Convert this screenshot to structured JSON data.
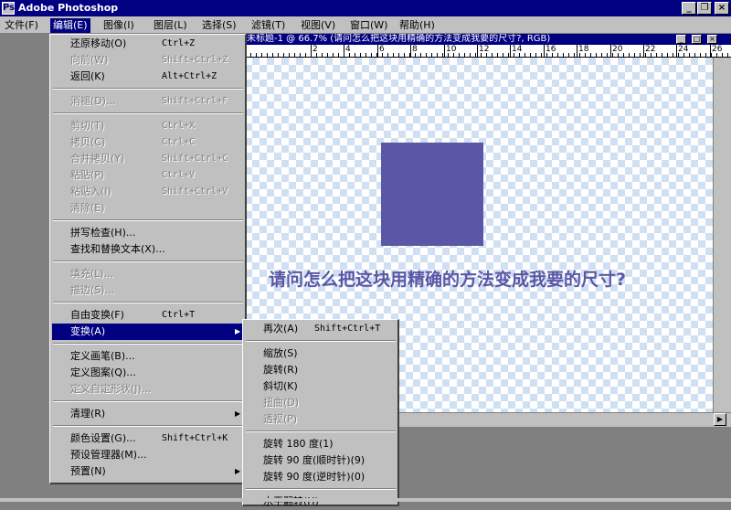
{
  "window": {
    "title": "Adobe Photoshop",
    "controls": [
      "_",
      "❐",
      "×"
    ]
  },
  "menubar": [
    {
      "label": "文件(F)"
    },
    {
      "label": "编辑(E)"
    },
    {
      "label": "图像(I)"
    },
    {
      "label": "图层(L)"
    },
    {
      "label": "选择(S)"
    },
    {
      "label": "滤镜(T)"
    },
    {
      "label": "视图(V)"
    },
    {
      "label": "窗口(W)"
    },
    {
      "label": "帮助(H)"
    }
  ],
  "document": {
    "title": "未标题-1 @ 66.7% (请问怎么把这块用精确的方法变成我要的尺寸?, RGB)",
    "controls": [
      "_",
      "□",
      "×"
    ],
    "ruler_numbers": [
      "2",
      "4",
      "6",
      "8",
      "10",
      "12",
      "14",
      "16",
      "18",
      "20",
      "22",
      "24",
      "26"
    ],
    "canvas_text": "请问怎么把这块用精确的方法变成我要的尺寸?",
    "colors": {
      "square": "#5a58a6",
      "checker": "#cfe0f3"
    }
  },
  "edit_menu": [
    {
      "label": "还原移动(O)",
      "shortcut": "Ctrl+Z",
      "disabled": false
    },
    {
      "label": "向前(W)",
      "shortcut": "Shift+Ctrl+Z",
      "disabled": true
    },
    {
      "label": "返回(K)",
      "shortcut": "Alt+Ctrl+Z",
      "disabled": false
    },
    {
      "sep": true
    },
    {
      "label": "消褪(D)...",
      "shortcut": "Shift+Ctrl+F",
      "disabled": true
    },
    {
      "sep": true
    },
    {
      "label": "剪切(T)",
      "shortcut": "Ctrl+X",
      "disabled": true
    },
    {
      "label": "拷贝(C)",
      "shortcut": "Ctrl+C",
      "disabled": true
    },
    {
      "label": "合并拷贝(Y)",
      "shortcut": "Shift+Ctrl+C",
      "disabled": true
    },
    {
      "label": "粘贴(P)",
      "shortcut": "Ctrl+V",
      "disabled": true
    },
    {
      "label": "粘贴入(I)",
      "shortcut": "Shift+Ctrl+V",
      "disabled": true
    },
    {
      "label": "清除(E)",
      "shortcut": "",
      "disabled": true
    },
    {
      "sep": true
    },
    {
      "label": "拼写检查(H)...",
      "shortcut": "",
      "disabled": false
    },
    {
      "label": "查找和替换文本(X)...",
      "shortcut": "",
      "disabled": false
    },
    {
      "sep": true
    },
    {
      "label": "填充(L)...",
      "shortcut": "",
      "disabled": true
    },
    {
      "label": "描边(S)...",
      "shortcut": "",
      "disabled": true
    },
    {
      "sep": true
    },
    {
      "label": "自由变换(F)",
      "shortcut": "Ctrl+T",
      "disabled": false
    },
    {
      "label": "变换(A)",
      "shortcut": "",
      "disabled": false,
      "submenu": true,
      "highlight": true
    },
    {
      "sep": true
    },
    {
      "label": "定义画笔(B)...",
      "shortcut": "",
      "disabled": false
    },
    {
      "label": "定义图案(Q)...",
      "shortcut": "",
      "disabled": false
    },
    {
      "label": "定义自定形状(J)...",
      "shortcut": "",
      "disabled": true
    },
    {
      "sep": true
    },
    {
      "label": "清理(R)",
      "shortcut": "",
      "disabled": false,
      "submenu": true
    },
    {
      "sep": true
    },
    {
      "label": "颜色设置(G)...",
      "shortcut": "Shift+Ctrl+K",
      "disabled": false
    },
    {
      "label": "预设管理器(M)...",
      "shortcut": "",
      "disabled": false
    },
    {
      "label": "预置(N)",
      "shortcut": "",
      "disabled": false,
      "submenu": true
    }
  ],
  "transform_menu": [
    {
      "label": "再次(A)",
      "shortcut": "Shift+Ctrl+T",
      "disabled": false
    },
    {
      "sep": true
    },
    {
      "label": "缩放(S)",
      "shortcut": "",
      "disabled": false
    },
    {
      "label": "旋转(R)",
      "shortcut": "",
      "disabled": false
    },
    {
      "label": "斜切(K)",
      "shortcut": "",
      "disabled": false
    },
    {
      "label": "扭曲(D)",
      "shortcut": "",
      "disabled": true
    },
    {
      "label": "透视(P)",
      "shortcut": "",
      "disabled": true
    },
    {
      "sep": true
    },
    {
      "label": "旋转 180 度(1)",
      "shortcut": "",
      "disabled": false
    },
    {
      "label": "旋转 90 度(顺时针)(9)",
      "shortcut": "",
      "disabled": false
    },
    {
      "label": "旋转 90 度(逆时针)(0)",
      "shortcut": "",
      "disabled": false
    },
    {
      "sep": true
    },
    {
      "label": "水平翻转(H)",
      "shortcut": "",
      "disabled": false
    }
  ]
}
